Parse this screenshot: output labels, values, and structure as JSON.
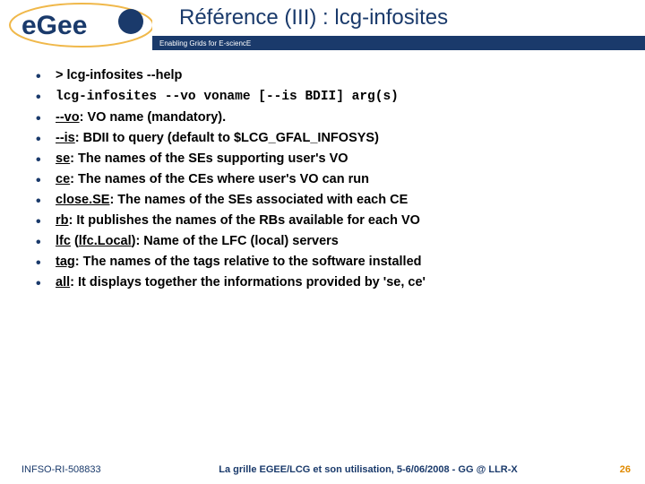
{
  "header": {
    "title": "Référence (III) : lcg-infosites",
    "subtitle": "Enabling Grids for E-sciencE",
    "logo_text_main": "eGee"
  },
  "bullets": {
    "b0_prefix": "> lcg-infosites --help",
    "b1": "lcg-infosites --vo voname [--is BDII] arg(s)",
    "b2_key": "--vo",
    "b2_rest": ": VO name (mandatory).",
    "b3_key": "--is",
    "b3_rest": ": BDII to query (default to $LCG_GFAL_INFOSYS)",
    "b4_key": "se",
    "b4_rest": ": The names of the SEs supporting user's VO",
    "b5_key": "ce",
    "b5_rest": ": The names of the CEs where user's VO can run",
    "b6_key": "close.SE",
    "b6_rest": ": The names of the SEs associated with each CE",
    "b7_key": "rb",
    "b7_rest": ": It publishes the names of the RBs available for each VO",
    "b8_key": "lfc",
    "b8_paren_open": " (",
    "b8_mid": "lfc.Local",
    "b8_paren_close": ")",
    "b8_rest": ": Name of the LFC (local) servers",
    "b9_key": "tag",
    "b9_rest": ": The names of the tags relative to the software installed",
    "b10_key": "all",
    "b10_rest": ": It displays together the informations provided by 'se, ce'"
  },
  "footer": {
    "left": "INFSO-RI-508833",
    "center": "La grille EGEE/LCG et son utilisation, 5-6/06/2008 - GG @ LLR-X",
    "page": "26"
  }
}
